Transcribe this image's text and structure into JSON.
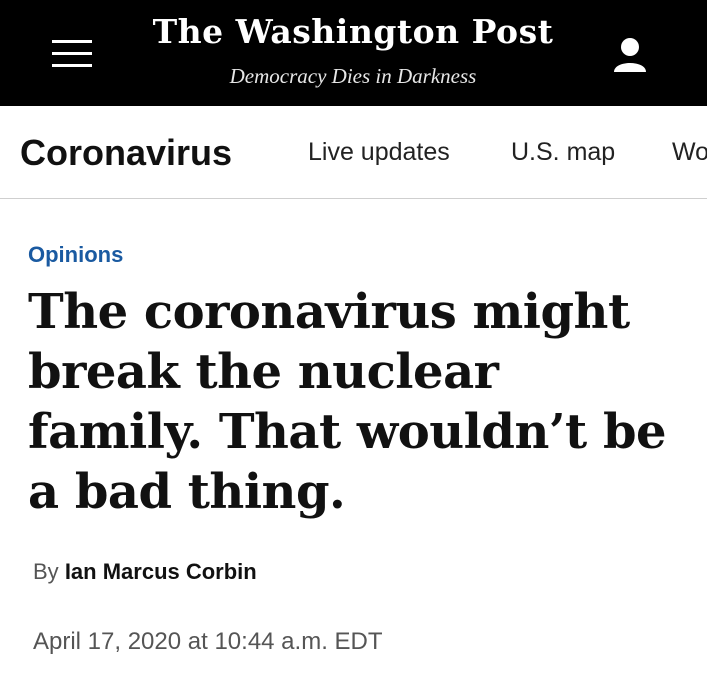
{
  "masthead": {
    "logo_text": "The Washington Post",
    "tagline": "Democracy Dies in Darkness",
    "background_color": "#000000",
    "menu_icon": "hamburger-menu-icon",
    "account_icon": "user-account-icon"
  },
  "section_nav": {
    "title": "Coronavirus",
    "links": [
      "Live updates",
      "U.S. map",
      "Wo"
    ]
  },
  "article": {
    "kicker": "Opinions",
    "kicker_color": "#1a5aa1",
    "headline": "The coronavirus might break the nuclear family. That wouldn’t be a bad thing.",
    "byline_prefix": "By",
    "author": "Ian Marcus Corbin",
    "timestamp": "April 17, 2020 at 10:44 a.m. EDT"
  }
}
